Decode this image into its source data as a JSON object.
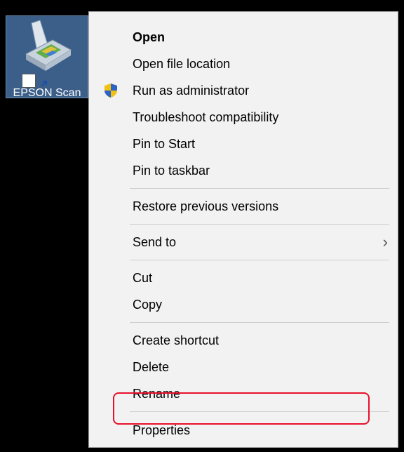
{
  "desktop": {
    "icon_label": "EPSON Scan",
    "icon_name": "scanner-icon"
  },
  "menu": {
    "items": [
      {
        "label": "Open"
      },
      {
        "label": "Open file location"
      },
      {
        "label": "Run as administrator",
        "icon": "uac-shield-icon"
      },
      {
        "label": "Troubleshoot compatibility"
      },
      {
        "label": "Pin to Start"
      },
      {
        "label": "Pin to taskbar"
      },
      {
        "label": "Restore previous versions"
      },
      {
        "label": "Send to",
        "submenu_glyph": "›"
      },
      {
        "label": "Cut"
      },
      {
        "label": "Copy"
      },
      {
        "label": "Create shortcut"
      },
      {
        "label": "Delete"
      },
      {
        "label": "Rename"
      },
      {
        "label": "Properties"
      }
    ]
  },
  "colors": {
    "menu_background": "#f2f2f2",
    "highlight": "#e8102a",
    "desktop_background": "#000000",
    "icon_selection": "#3c5f8a"
  }
}
